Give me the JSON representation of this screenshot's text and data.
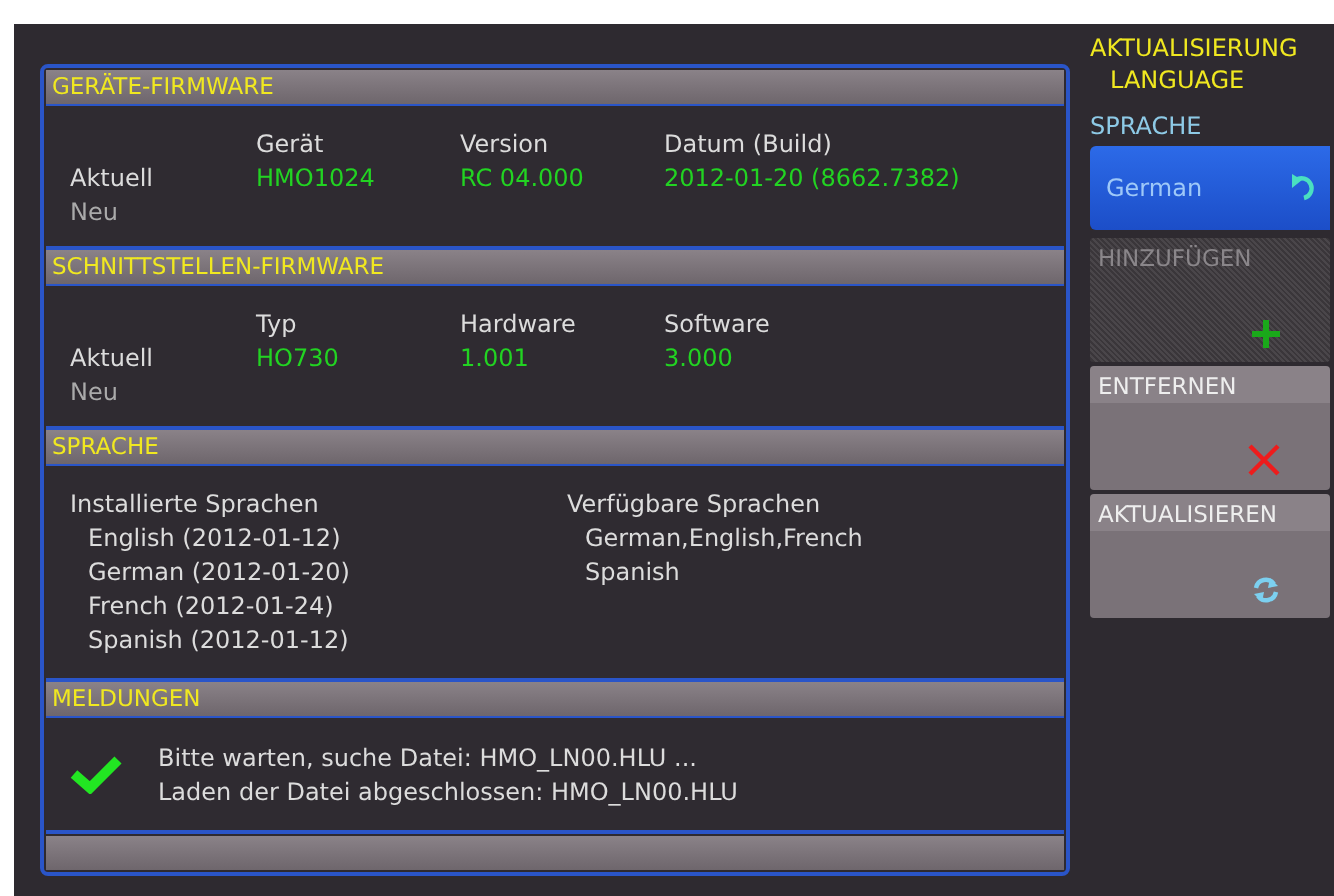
{
  "sections": [
    {
      "kind": "firmware",
      "title": "GERÄTE-FIRMWARE",
      "columns": [
        "Gerät",
        "Version",
        "Datum (Build)"
      ],
      "rows": [
        {
          "label": "Aktuell",
          "values": [
            "HMO1024",
            "RC 04.000",
            "2012-01-20 (8662.7382)"
          ]
        },
        {
          "label": "Neu",
          "values": []
        }
      ]
    },
    {
      "kind": "firmware",
      "title": "SCHNITTSTELLEN-FIRMWARE",
      "columns": [
        "Typ",
        "Hardware",
        "Software"
      ],
      "rows": [
        {
          "label": "Aktuell",
          "values": [
            "HO730",
            "1.001",
            "3.000"
          ]
        },
        {
          "label": "Neu",
          "values": []
        }
      ]
    },
    {
      "kind": "languages",
      "title": "SPRACHE",
      "installed_heading": "Installierte Sprachen",
      "installed": [
        "English (2012-01-12)",
        "German (2012-01-20)",
        "French (2012-01-24)",
        "Spanish (2012-01-12)"
      ],
      "available_heading": "Verfügbare Sprachen",
      "available": [
        "German,English,French",
        "Spanish"
      ]
    },
    {
      "kind": "messages",
      "title": "MELDUNGEN",
      "lines": [
        "Bitte warten, suche Datei: HMO_LN00.HLU ...",
        "Laden der Datei abgeschlossen: HMO_LN00.HLU"
      ]
    }
  ],
  "side_menu": {
    "title_lines": [
      "AKTUALISIERUNG",
      "LANGUAGE"
    ],
    "label": "SPRACHE",
    "items": [
      {
        "kind": "select",
        "label": "German",
        "disabled": false
      },
      {
        "kind": "add",
        "label": "HINZUFÜGEN",
        "disabled": true
      },
      {
        "kind": "remove",
        "label": "ENTFERNEN",
        "disabled": false
      },
      {
        "kind": "update",
        "label": "AKTUALISIEREN",
        "disabled": false
      }
    ]
  }
}
